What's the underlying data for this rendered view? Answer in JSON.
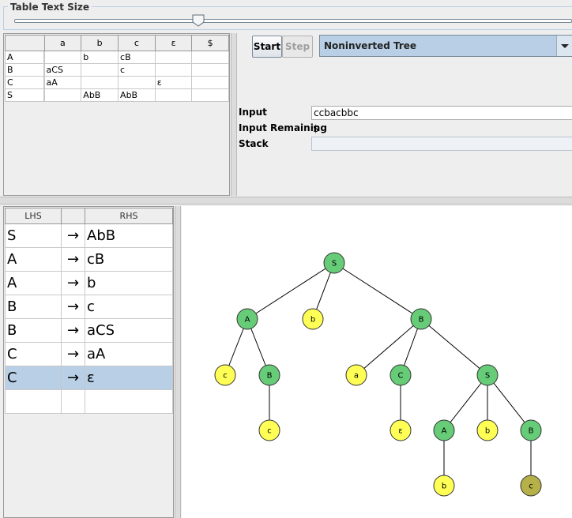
{
  "size_panel": {
    "title": "Table Text Size",
    "slider_fraction": 0.33
  },
  "parse_table": {
    "columns": [
      "a",
      "b",
      "c",
      "ε",
      "$"
    ],
    "rows": [
      {
        "head": "A",
        "cells": [
          "",
          "b",
          "cB",
          "",
          ""
        ]
      },
      {
        "head": "B",
        "cells": [
          "aCS",
          "",
          "c",
          "",
          ""
        ]
      },
      {
        "head": "C",
        "cells": [
          "aA",
          "",
          "",
          "ε",
          ""
        ]
      },
      {
        "head": "S",
        "cells": [
          "",
          "AbB",
          "AbB",
          "",
          ""
        ]
      }
    ]
  },
  "controls": {
    "start_label": "Start",
    "step_label": "Step",
    "view_mode": "Noninverted Tree",
    "input_label": "Input",
    "input_value": "ccbacbbc",
    "remaining_label": "Input Remaining",
    "remaining_value": "$",
    "stack_label": "Stack",
    "stack_value": ""
  },
  "grammar": {
    "headers": {
      "lhs": "LHS",
      "arrow": "",
      "rhs": "RHS"
    },
    "arrow_glyph": "→",
    "rows": [
      {
        "lhs": "S",
        "rhs": "AbB"
      },
      {
        "lhs": "A",
        "rhs": "cB"
      },
      {
        "lhs": "A",
        "rhs": "b"
      },
      {
        "lhs": "B",
        "rhs": "c"
      },
      {
        "lhs": "B",
        "rhs": "aCS"
      },
      {
        "lhs": "C",
        "rhs": "aA"
      },
      {
        "lhs": "C",
        "rhs": "ε"
      }
    ],
    "selected_row": 6
  },
  "tree": {
    "colors": {
      "nonterminal": "#66cc77",
      "terminal": "#ffff55",
      "current": "#b5b048"
    },
    "nodes": [
      {
        "id": "n0",
        "label": "S",
        "kind": "nonterminal"
      },
      {
        "id": "n1",
        "label": "A",
        "kind": "nonterminal",
        "parent": "n0"
      },
      {
        "id": "n2",
        "label": "b",
        "kind": "terminal",
        "parent": "n0"
      },
      {
        "id": "n3",
        "label": "B",
        "kind": "nonterminal",
        "parent": "n0"
      },
      {
        "id": "n4",
        "label": "c",
        "kind": "terminal",
        "parent": "n1"
      },
      {
        "id": "n5",
        "label": "B",
        "kind": "nonterminal",
        "parent": "n1"
      },
      {
        "id": "n6",
        "label": "a",
        "kind": "terminal",
        "parent": "n3"
      },
      {
        "id": "n7",
        "label": "C",
        "kind": "nonterminal",
        "parent": "n3"
      },
      {
        "id": "n8",
        "label": "S",
        "kind": "nonterminal",
        "parent": "n3"
      },
      {
        "id": "n9",
        "label": "c",
        "kind": "terminal",
        "parent": "n5"
      },
      {
        "id": "n10",
        "label": "ε",
        "kind": "terminal",
        "parent": "n7"
      },
      {
        "id": "n11",
        "label": "A",
        "kind": "nonterminal",
        "parent": "n8"
      },
      {
        "id": "n12",
        "label": "b",
        "kind": "terminal",
        "parent": "n8"
      },
      {
        "id": "n13",
        "label": "B",
        "kind": "nonterminal",
        "parent": "n8"
      },
      {
        "id": "n14",
        "label": "b",
        "kind": "terminal",
        "parent": "n11"
      },
      {
        "id": "n15",
        "label": "c",
        "kind": "current",
        "parent": "n13"
      }
    ]
  }
}
